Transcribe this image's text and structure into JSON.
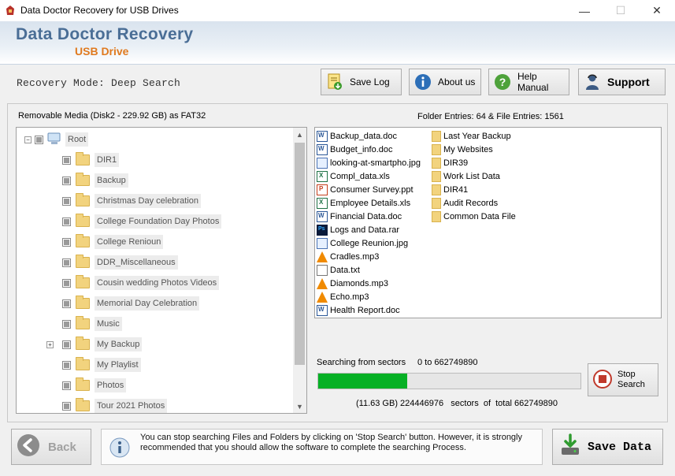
{
  "window": {
    "title": "Data Doctor Recovery for USB Drives",
    "minimize": "—",
    "maximize": "☐",
    "close": "✕"
  },
  "banner": {
    "brand": "Data Doctor Recovery",
    "product": "USB Drive"
  },
  "toolbar": {
    "mode": "Recovery Mode: Deep Search",
    "save_log": "Save Log",
    "about_us": "About us",
    "help_manual": "Help Manual",
    "support": "Support"
  },
  "media": {
    "label": "Removable Media (Disk2 - 229.92 GB) as FAT32",
    "entries": "Folder Entries: 64 & File Entries: 1561"
  },
  "tree": {
    "root": "Root",
    "items": [
      {
        "label": "DIR1"
      },
      {
        "label": "Backup"
      },
      {
        "label": "Christmas Day celebration"
      },
      {
        "label": "College Foundation Day Photos"
      },
      {
        "label": "College Renioun"
      },
      {
        "label": "DDR_Miscellaneous"
      },
      {
        "label": "Cousin wedding Photos Videos"
      },
      {
        "label": "Memorial Day Celebration"
      },
      {
        "label": "Music"
      },
      {
        "label": "My Backup"
      },
      {
        "label": "My Playlist"
      },
      {
        "label": "Photos"
      },
      {
        "label": "Tour 2021 Photos"
      }
    ]
  },
  "files": {
    "col1": [
      {
        "name": "Backup_data.doc",
        "icon": "word-doc-icon"
      },
      {
        "name": "Budget_info.doc",
        "icon": "word-doc-icon"
      },
      {
        "name": "looking-at-smartpho.jpg",
        "icon": "image-icon"
      },
      {
        "name": "Compl_data.xls",
        "icon": "excel-icon"
      },
      {
        "name": "Consumer Survey.ppt",
        "icon": "powerpoint-icon"
      },
      {
        "name": "Employee Details.xls",
        "icon": "excel-icon"
      },
      {
        "name": "Financial Data.doc",
        "icon": "word-doc-icon"
      },
      {
        "name": "Logs and Data.rar",
        "icon": "archive-icon"
      },
      {
        "name": "College Reunion.jpg",
        "icon": "image-icon"
      },
      {
        "name": "Cradles.mp3",
        "icon": "audio-icon"
      },
      {
        "name": "Data.txt",
        "icon": "text-file-icon"
      },
      {
        "name": "Diamonds.mp3",
        "icon": "audio-icon"
      },
      {
        "name": "Echo.mp3",
        "icon": "audio-icon"
      },
      {
        "name": "Health Report.doc",
        "icon": "word-doc-icon"
      }
    ],
    "col2": [
      {
        "name": "Last Year Backup"
      },
      {
        "name": "My Websites"
      },
      {
        "name": "DIR39"
      },
      {
        "name": "Work List Data"
      },
      {
        "name": "DIR41"
      },
      {
        "name": "Audit Records"
      },
      {
        "name": "Common Data File"
      }
    ]
  },
  "progress": {
    "label": "Searching from sectors",
    "range": "0 to 662749890",
    "summary": "(11.63 GB) 224446976   sectors  of  total 662749890",
    "fraction": 0.3387
  },
  "buttons": {
    "stop_search": "Stop Search",
    "back": "Back",
    "save_data": "Save Data"
  },
  "info": {
    "message": "You can stop searching Files and Folders by clicking on 'Stop Search' button. However, it is strongly recommended that you should allow the software to complete the searching Process."
  },
  "colors": {
    "accent": "#4a6e96",
    "product": "#e07a1f",
    "progress": "#06b025"
  }
}
